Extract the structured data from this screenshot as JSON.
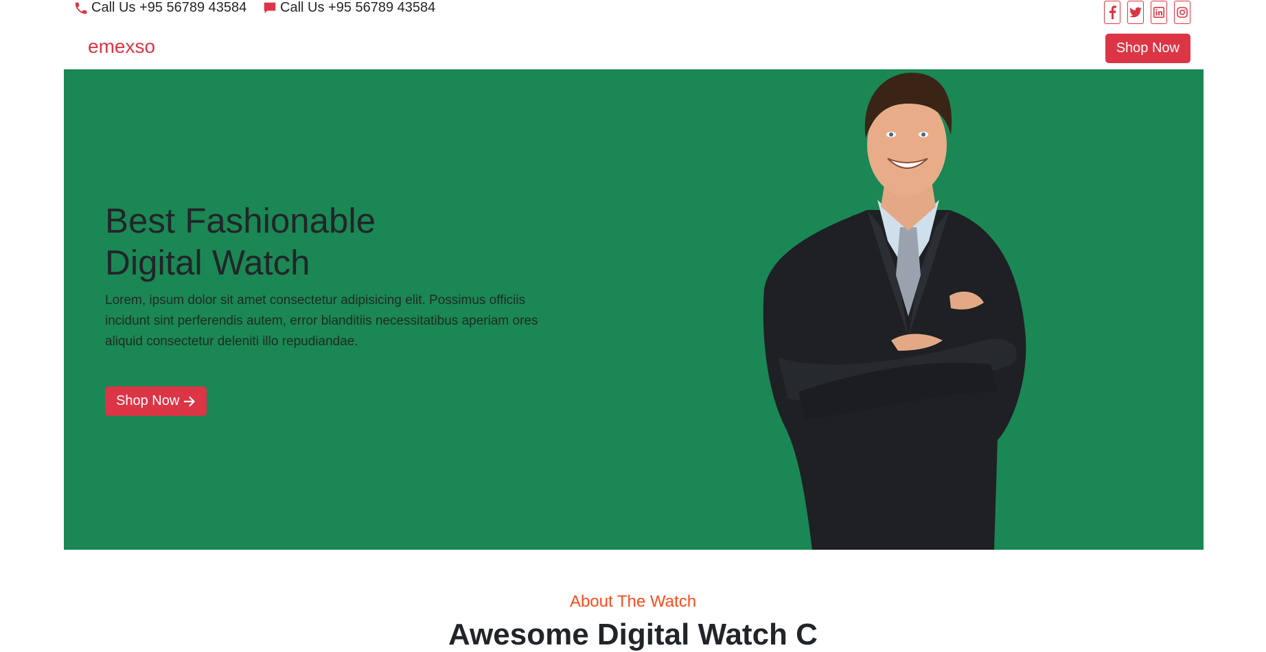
{
  "topbar": {
    "phone": {
      "icon": "phone-icon",
      "text": "Call Us +95 56789 43584"
    },
    "chat": {
      "icon": "chat-icon",
      "text": "Call Us +95 56789 43584"
    },
    "social": [
      "facebook-icon",
      "twitter-icon",
      "linkedin-icon",
      "instagram-icon"
    ]
  },
  "navbar": {
    "brand": "emexso",
    "button_label": "Shop Now"
  },
  "hero": {
    "title_line1": "Best Fashionable",
    "title_line2": "Digital Watch",
    "text": "Lorem, ipsum dolor sit amet consectetur adipisicing elit. Possimus officiis incidunt sint perferendis autem, error blanditiis necessitatibus aperiam ores aliquid consectetur deleniti illo repudiandae.",
    "button_label": "Shop Now",
    "button_icon": "arrow-right-icon",
    "background_color": "#1b8754"
  },
  "about": {
    "subtitle": "About The Watch",
    "title": "Awesome Digital Watch C"
  },
  "colors": {
    "accent": "#dc3545",
    "about_subtitle": "#fd4b1b",
    "hero_bg": "#1b8754"
  }
}
